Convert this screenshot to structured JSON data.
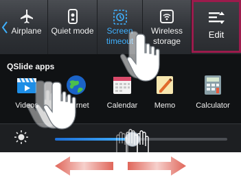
{
  "toggles": [
    {
      "label": "Airplane",
      "icon": "airplane-icon",
      "active": false
    },
    {
      "label": "Quiet mode",
      "icon": "quiet-mode-icon",
      "active": false
    },
    {
      "label": "Screen timeout",
      "icon": "screen-timeout-icon",
      "active": true
    },
    {
      "label": "Wireless storage",
      "icon": "wireless-storage-icon",
      "active": false
    }
  ],
  "edit": {
    "label": "Edit",
    "icon": "edit-list-icon"
  },
  "qslide": {
    "title": "QSlide apps",
    "apps": [
      {
        "label": "Videos",
        "icon": "videos-icon"
      },
      {
        "label": "Internet",
        "icon": "internet-globe-icon"
      },
      {
        "label": "Calendar",
        "icon": "calendar-icon"
      },
      {
        "label": "Memo",
        "icon": "memo-icon"
      },
      {
        "label": "Calculator",
        "icon": "calculator-icon"
      }
    ]
  },
  "brightness": {
    "level": 0.45,
    "icon": "brightness-icon"
  },
  "colors": {
    "accent": "#3fb1ff",
    "edit_highlight": "#9c1b4c",
    "arrow": "#e0665a"
  }
}
